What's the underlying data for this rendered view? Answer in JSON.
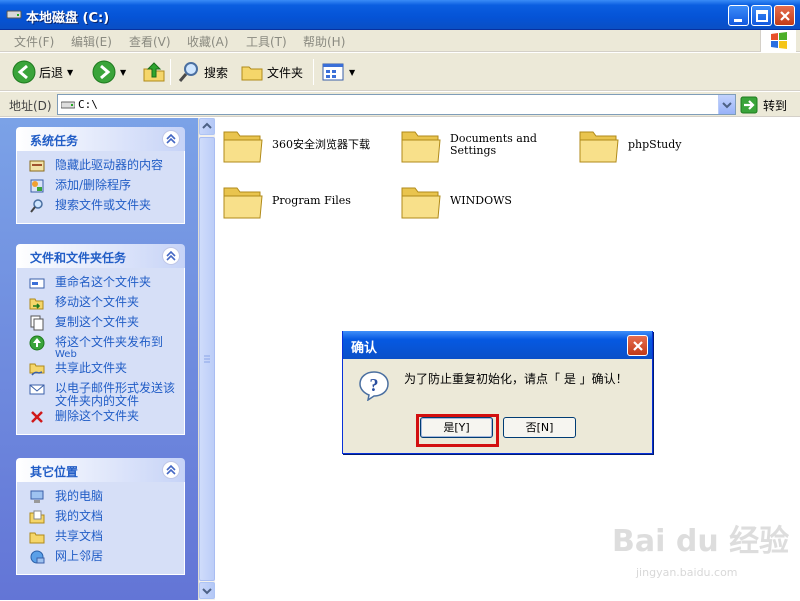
{
  "window": {
    "title": "本地磁盘 (C:)"
  },
  "menu": [
    "文件(F)",
    "编辑(E)",
    "查看(V)",
    "收藏(A)",
    "工具(T)",
    "帮助(H)"
  ],
  "toolbar": {
    "back": "后退",
    "search": "搜索",
    "folders": "文件夹"
  },
  "address": {
    "label": "地址(D)",
    "value": "C:\\",
    "go": "转到"
  },
  "tasks": {
    "system": {
      "title": "系统任务",
      "items": [
        "隐藏此驱动器的内容",
        "添加/删除程序",
        "搜索文件或文件夹"
      ]
    },
    "file_folder": {
      "title": "文件和文件夹任务",
      "items": [
        {
          "text": "重命名这个文件夹"
        },
        {
          "text": "移动这个文件夹"
        },
        {
          "text": "复制这个文件夹"
        },
        {
          "text": "将这个文件夹发布到",
          "sub": "Web"
        },
        {
          "text": "共享此文件夹"
        },
        {
          "text": "以电子邮件形式发送该文件夹内的文件"
        },
        {
          "text": "删除这个文件夹"
        }
      ]
    },
    "other": {
      "title": "其它位置",
      "items": [
        "我的电脑",
        "我的文档",
        "共享文档",
        "网上邻居"
      ]
    }
  },
  "folders": [
    {
      "name": "360安全浏览器下载"
    },
    {
      "name1": "Documents and",
      "name2": "Settings"
    },
    {
      "name": "phpStudy"
    },
    {
      "name": "Program Files"
    },
    {
      "name": "WINDOWS"
    }
  ],
  "dialog": {
    "title": "确认",
    "message": "为了防止重复初始化，请点「 是 」确认！",
    "yes": "是[Y]",
    "no": "否[N]"
  },
  "watermark": {
    "brand": "Bai du 经验",
    "url": "jingyan.baidu.com"
  },
  "colors": {
    "titlebar": "#0553d6",
    "taskpane": "#6f8ddf",
    "link": "#215dc6",
    "highlight": "#d20f0f"
  }
}
